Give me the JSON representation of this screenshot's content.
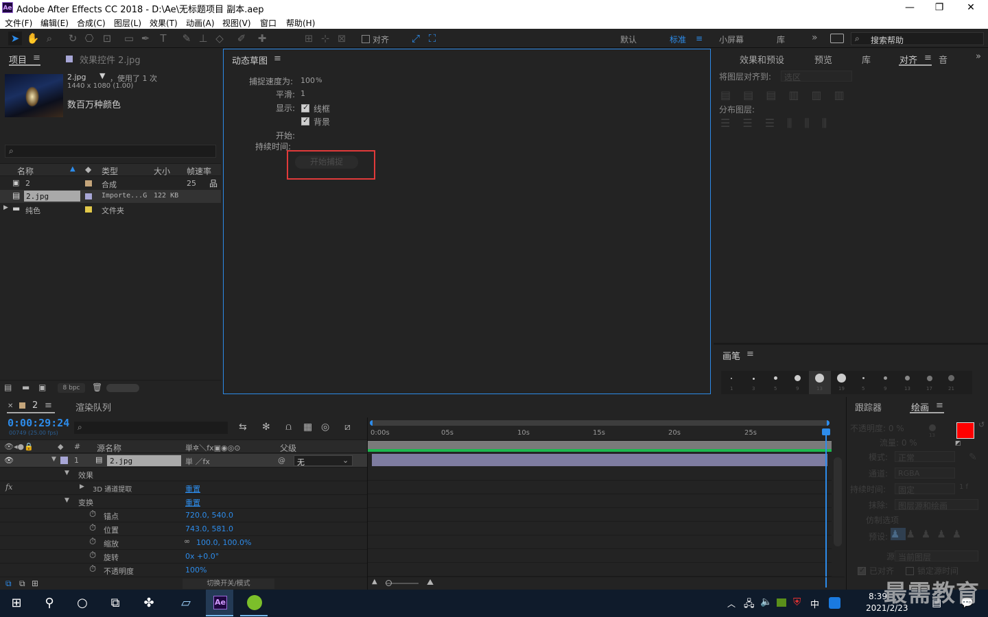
{
  "app": {
    "badge": "Ae",
    "title": "Adobe After Effects CC 2018 - D:\\Ae\\无标题项目 副本.aep"
  },
  "window": {
    "minimize": "—",
    "restore": "❐",
    "close": "✕"
  },
  "menu": [
    "文件(F)",
    "编辑(E)",
    "合成(C)",
    "图层(L)",
    "效果(T)",
    "动画(A)",
    "视图(V)",
    "窗口",
    "帮助(H)"
  ],
  "toolbar": {
    "align_label": "对齐",
    "workspaces": [
      "默认",
      "标准",
      "小屏幕",
      "库"
    ],
    "active_workspace": "标准",
    "more": "»",
    "search_placeholder": "搜索帮助"
  },
  "project": {
    "tab_project": "项目",
    "tab_effects": "效果控件 2.jpg",
    "asset_name": "2.jpg",
    "asset_used": "，使用了 1 次",
    "asset_dims": "1440 x 1080 (1.00)",
    "asset_colors": "数百万种颜色",
    "columns": [
      "名称",
      "类型",
      "大小",
      "帧速率"
    ],
    "rows": [
      {
        "name": "2",
        "type": "合成",
        "size": "",
        "fps": "25",
        "color": "#c4a57b"
      },
      {
        "name": "2.jpg",
        "type": "Importe...G",
        "size": "122 KB",
        "fps": "",
        "color": "#a7a6d6"
      },
      {
        "name": "纯色",
        "type": "文件夹",
        "size": "",
        "fps": "",
        "color": "#e2c94a"
      }
    ],
    "bpc": "8 bpc"
  },
  "sketch": {
    "tab": "动态草图",
    "capture_speed_label": "捕捉速度为:",
    "capture_speed_value": "100",
    "capture_speed_unit": "%",
    "smooth_label": "平滑:",
    "smooth_value": "1",
    "display_label": "显示:",
    "wireframe": "线框",
    "background": "背景",
    "start_label": "开始:",
    "duration_label": "持续时间:",
    "start_capture_button": "开始捕捉"
  },
  "right": {
    "tabs": [
      "效果和预设",
      "预览",
      "库",
      "对齐",
      "音频"
    ],
    "align_to_label": "将图层对齐到:",
    "align_to_value": "选区",
    "distribute_label": "分布图层:",
    "brush_tab": "画笔",
    "brush_sizes": [
      "1",
      "3",
      "5",
      "9",
      "13",
      "19",
      "5",
      "9",
      "13",
      "17",
      "21"
    ]
  },
  "timeline": {
    "tab_comp": "2",
    "tab_render": "渲染队列",
    "timecode": "0:00:29:24",
    "timecode_sub": "00749 (25.00 fps)",
    "col_num": "#",
    "col_source": "源名称",
    "col_parent": "父级",
    "layer_num": "1",
    "layer_name": "2.jpg",
    "layer_parent": "无",
    "effects_label": "效果",
    "effect_3d": "3D 通道提取",
    "reset": "重置",
    "transform_label": "变换",
    "props": [
      {
        "name": "锚点",
        "value": "720.0, 540.0"
      },
      {
        "name": "位置",
        "value": "743.0, 581.0"
      },
      {
        "name": "缩放",
        "value": "100.0, 100.0%"
      },
      {
        "name": "旋转",
        "value": "0x +0.0°"
      },
      {
        "name": "不透明度",
        "value": "100%"
      }
    ],
    "ruler": [
      "0:00s",
      "05s",
      "10s",
      "15s",
      "20s",
      "25s"
    ],
    "toggle_label": "切换开关/模式"
  },
  "tracker": {
    "tab_tracker": "跟踪器",
    "tab_paint": "绘画",
    "opacity": "不透明度: 0 %",
    "flow": "流量: 0 %",
    "mode_label": "模式:",
    "mode_value": "正常",
    "channel_label": "通道:",
    "channel_value": "RGBA",
    "duration_label": "持续时间:",
    "duration_value": "固定",
    "duration_extra": "1 f",
    "erase_label": "抹除:",
    "erase_value": "图层源和绘画",
    "clone_label": "仿制选项",
    "preset_label": "预设:",
    "source_label": "源:",
    "source_value": "当前图层",
    "aligned_label": "已对齐",
    "lock_label": "锁定源时间",
    "brush_num": "13",
    "fg_color": "#ff0000",
    "bg_color": "#ffffff"
  },
  "taskbar": {
    "time": "8:39",
    "date": "2021/2/23",
    "ime": "中",
    "watermark": "最需教育"
  }
}
